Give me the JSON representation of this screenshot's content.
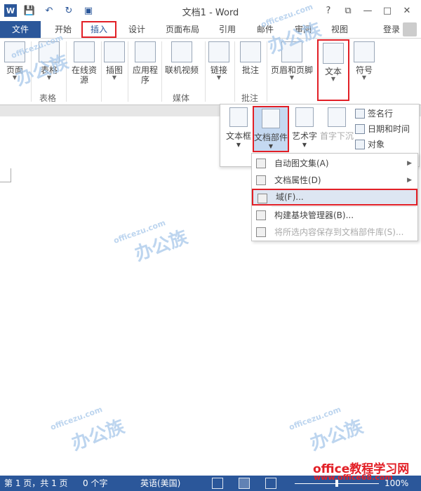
{
  "window": {
    "title": "文档1 - Word",
    "buttons": {
      "help": "?",
      "restore": "⧉",
      "minimize": "—",
      "maximize": "□",
      "close": "✕"
    }
  },
  "qat": {
    "logo": "W",
    "save": "💾",
    "undo": "↶",
    "redo": "↻",
    "touch": "▣"
  },
  "tabs": [
    "文件",
    "开始",
    "插入",
    "设计",
    "页面布局",
    "引用",
    "邮件",
    "审阅",
    "视图"
  ],
  "login": "登录",
  "ribbon": {
    "buttons": [
      {
        "label": "页面",
        "icon": "page-icon"
      },
      {
        "label": "表格",
        "icon": "table-icon"
      },
      {
        "label": "在线资源",
        "icon": "online-resource-icon"
      },
      {
        "label": "插图",
        "icon": "illustration-icon"
      },
      {
        "label": "应用程序",
        "icon": "apps-icon"
      },
      {
        "label": "联机视频",
        "icon": "video-icon"
      },
      {
        "label": "链接",
        "icon": "link-icon"
      },
      {
        "label": "批注",
        "icon": "comment-icon"
      },
      {
        "label": "页眉和页脚",
        "icon": "header-footer-icon"
      },
      {
        "label": "文本",
        "icon": "text-icon"
      },
      {
        "label": "符号",
        "icon": "symbol-icon"
      }
    ],
    "groups": [
      "表格",
      "媒体",
      "批注"
    ]
  },
  "text_panel": {
    "items": [
      {
        "label": "文本框",
        "disabled": false
      },
      {
        "label": "文档部件",
        "disabled": false
      },
      {
        "label": "艺术字",
        "disabled": false
      },
      {
        "label": "首字下沉",
        "disabled": true
      }
    ],
    "small_items": [
      "签名行",
      "日期和时间",
      "对象"
    ]
  },
  "menu": {
    "items": [
      {
        "label": "自动图文集(A)",
        "submenu": true,
        "disabled": false
      },
      {
        "label": "文档属性(D)",
        "submenu": true,
        "disabled": false
      },
      {
        "label": "域(F)...",
        "submenu": false,
        "disabled": false
      },
      {
        "label": "构建基块管理器(B)...",
        "submenu": false,
        "disabled": false
      },
      {
        "label": "将所选内容保存到文档部件库(S)...",
        "submenu": false,
        "disabled": true
      }
    ]
  },
  "status": {
    "page": "第 1 页，共 1 页",
    "words": "0 个字",
    "lang": "英语(美国)",
    "zoom": "100%"
  },
  "watermark": {
    "logo": "办公族",
    "url": "officezu.com",
    "brand": "office教程学习网",
    "brand_url": "www.office68.com"
  },
  "colors": {
    "accent": "#2b579a",
    "highlight": "#e21f26",
    "watermark": "#a7c8ea"
  }
}
